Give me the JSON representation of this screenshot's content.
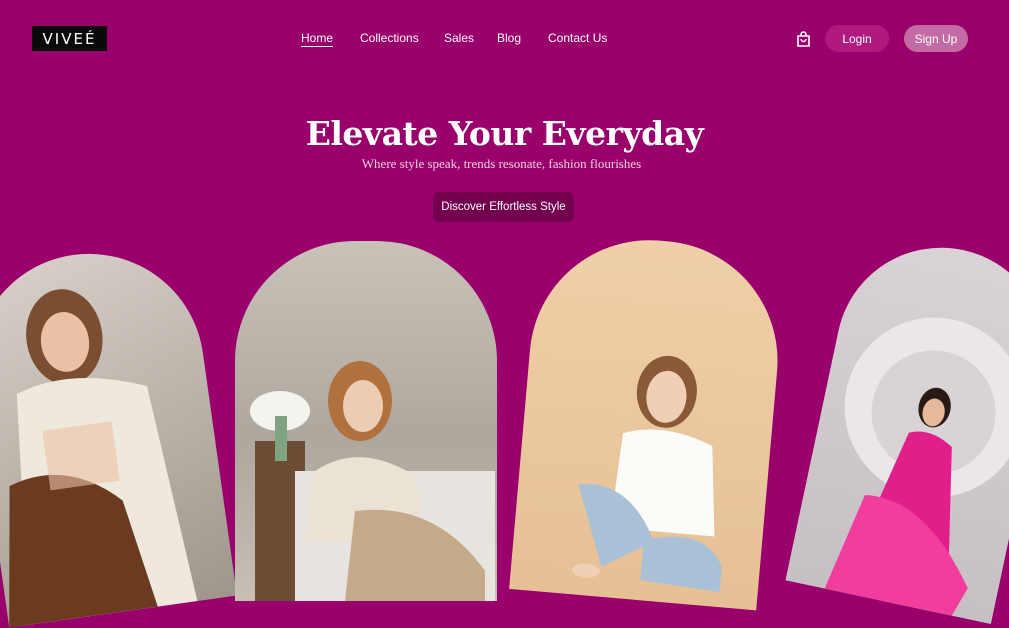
{
  "header": {
    "logo": "VIVEÉ",
    "nav": [
      {
        "label": "Home",
        "active": true
      },
      {
        "label": "Collections",
        "active": false
      },
      {
        "label": "Sales",
        "active": false
      },
      {
        "label": "Blog",
        "active": false
      },
      {
        "label": "Contact Us",
        "active": false
      }
    ],
    "cart_icon": "shopping-bag-icon",
    "login_label": "Login",
    "signup_label": "Sign Up"
  },
  "hero": {
    "title": "Elevate Your Everyday",
    "subtitle": "Where style speak, trends resonate, fashion flourishes",
    "cta_label": "Discover Effortless Style"
  },
  "colors": {
    "background": "#9a006b",
    "login_bg": "#b0197e",
    "signup_bg": "#c46aa5",
    "cta_bg": "#72004f"
  }
}
